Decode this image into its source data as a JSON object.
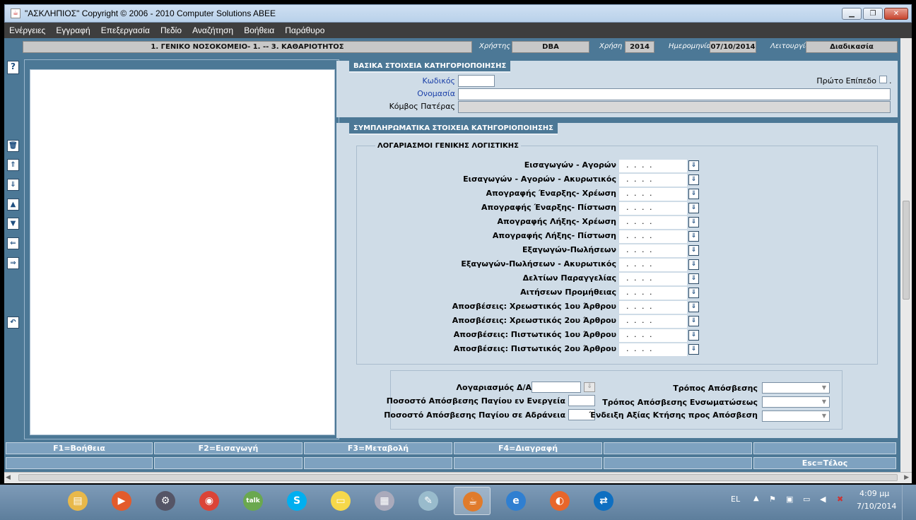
{
  "window": {
    "title": "\"ΑΣΚΛΗΠΙΟΣ\" Copyright © 2006 - 2010 Computer Solutions ABEE",
    "app_icon": "java-icon"
  },
  "menu": [
    "Ενέργειες",
    "Εγγραφή",
    "Επεξεργασία",
    "Πεδίο",
    "Αναζήτηση",
    "Βοήθεια",
    "Παράθυρο"
  ],
  "header": {
    "org": "1. ΓΕΝΙΚΟ ΝΟΣΟΚΟΜΕΙΟ- 1. -- 3. ΚΑΘΑΡΙΟΤΗΤΟΣ",
    "user_label": "Χρήστης",
    "user_value": "DBA",
    "year_label": "Χρήση",
    "year_value": "2014",
    "date_label": "Ημερομηνία",
    "date_value": "07/10/2014",
    "mode_label": "Λειτουργία",
    "mode_value": "Διαδικασία"
  },
  "basic": {
    "title": "ΒΑΣΙΚΑ ΣΤΟΙΧΕΙΑ ΚΑΤΗΓΟΡΙΟΠΟΙΗΣΗΣ",
    "code_label": "Κωδικός",
    "name_label": "Ονομασία",
    "parent_label": "Κόμβος Πατέρας",
    "first_level_label": "Πρώτο Επίπεδο",
    "code_value": "",
    "name_value": "",
    "parent_value": ""
  },
  "extra": {
    "title": "ΣΥΜΠΛΗΡΩΜΑΤΙΚΑ ΣΤΟΙΧΕΙΑ ΚΑΤΗΓΟΡΙΟΠΟΙΗΣΗΣ",
    "accounts_title": "ΛΟΓΑΡΙΑΣΜΟΙ ΓΕΝΙΚΗΣ ΛΟΓΙΣΤΙΚΗΣ",
    "account_mask": ". . . .",
    "accounts": [
      "Εισαγωγών - Αγορών",
      "Εισαγωγών - Αγορών  - Ακυρωτικός",
      "Απογραφής Έναρξης- Χρέωση",
      "Απογραφής Έναρξης- Πίστωση",
      "Απογραφής Λήξης- Χρέωση",
      "Απογραφής Λήξης- Πίστωση",
      "Εξαγωγών-Πωλήσεων",
      "Εξαγωγών-Πωλήσεων - Ακυρωτικός",
      "Δελτίων Παραγγελίας",
      "Αιτήσεων Προμήθειας",
      "Αποσβέσεις: Χρεωστικός 1ου Άρθρου",
      "Αποσβέσεις: Χρεωστικός 2ου Άρθρου",
      "Αποσβέσεις: Πιστωτικός 1ου Άρθρου",
      "Αποσβέσεις: Πιστωτικός 2ου Άρθρου"
    ],
    "account_da_label": "Λογαριασμός Δ/Α",
    "pct_active_label": "Ποσοστό Απόσβεσης Παγίου εν Ενεργεία",
    "pct_idle_label": "Ποσοστό Απόσβεσης Παγίου σε Αδράνεια",
    "dep_method_label": "Τρόπος Απόσβεσης",
    "dep_method_inc_label": "Τρόπος Απόσβεσης Ενσωματώσεως",
    "acq_value_label": "Ένδειξη Αξίας Κτήσης προς Απόσβεση"
  },
  "fkeys": {
    "row1": [
      "F1=Βοήθεια",
      "F2=Εισαγωγή",
      "F3=Μεταβολή",
      "F4=Διαγραφή",
      "",
      ""
    ],
    "row2": [
      "",
      "",
      "",
      "",
      "",
      "Esc=Τέλος"
    ]
  },
  "taskbar": {
    "lang": "EL",
    "time": "4:09 μμ",
    "date": "7/10/2014",
    "apps": [
      "file-explorer-icon",
      "media-player-icon",
      "network-icon",
      "chrome-icon",
      "google-talk-icon",
      "skype-icon",
      "sticky-notes-icon",
      "calculator-icon",
      "notepad-icon",
      "java-icon",
      "ie-icon",
      "firefox-icon",
      "teamviewer-icon"
    ]
  }
}
